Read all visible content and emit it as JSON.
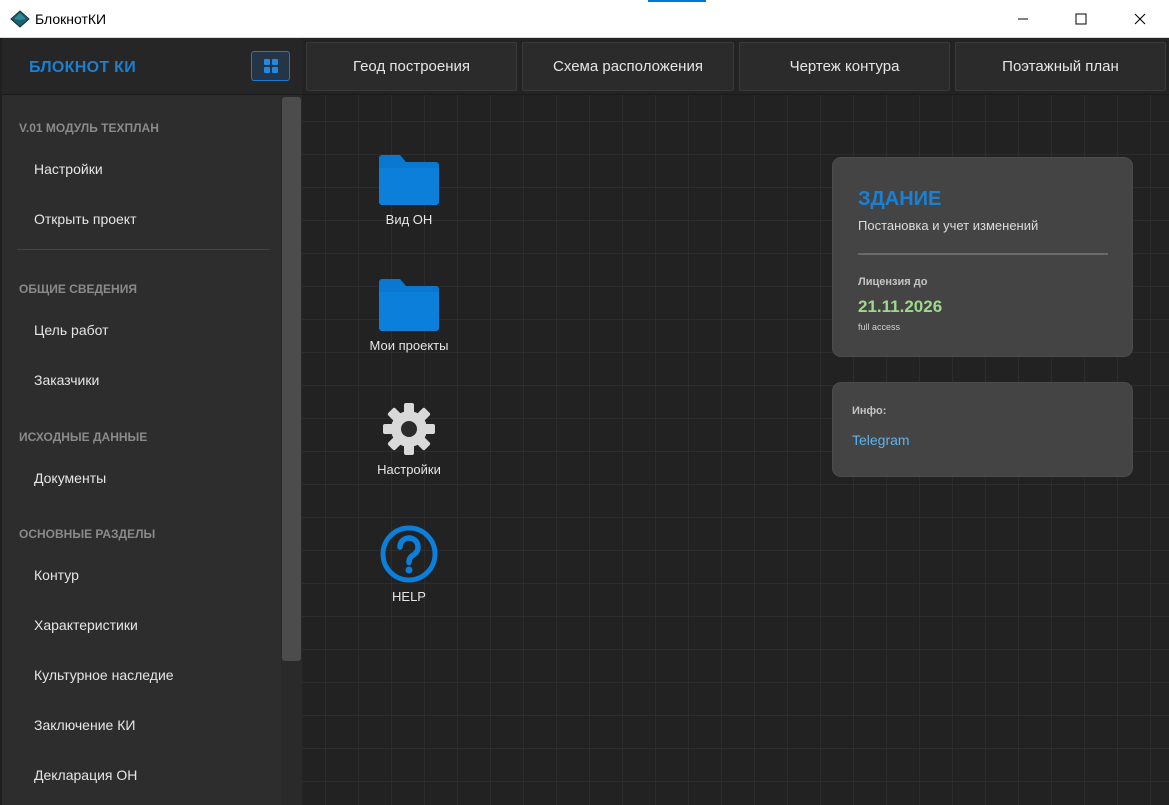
{
  "window": {
    "title": "БлокнотКИ",
    "minimize_icon": "minimize-icon",
    "maximize_icon": "maximize-icon",
    "close_icon": "close-icon"
  },
  "sidebar": {
    "brand": "БЛОКНОТ КИ",
    "grid_icon": "grid-icon",
    "sections": [
      {
        "header": "V.01 МОДУЛЬ ТЕХПЛАН",
        "items": [
          "Настройки",
          "Открыть проект"
        ]
      },
      {
        "header": "ОБЩИЕ СВЕДЕНИЯ",
        "items": [
          "Цель работ",
          "Заказчики"
        ]
      },
      {
        "header": "ИСХОДНЫЕ ДАННЫЕ",
        "items": [
          "Документы"
        ]
      },
      {
        "header": "ОСНОВНЫЕ РАЗДЕЛЫ",
        "items": [
          "Контур",
          "Характеристики",
          "Культурное наследие",
          "Заключение КИ",
          "Декларация ОН"
        ]
      }
    ]
  },
  "tabs": [
    "Геод построения",
    "Схема расположения",
    "Чертеж контура",
    "Поэтажный план"
  ],
  "desktop": {
    "icons": [
      {
        "label": "Вид ОН",
        "icon": "folder-icon"
      },
      {
        "label": "Мои проекты",
        "icon": "folder-icon"
      },
      {
        "label": "Настройки",
        "icon": "gear-icon"
      },
      {
        "label": "HELP",
        "icon": "help-icon"
      }
    ]
  },
  "cards": {
    "building": {
      "title": "ЗДАНИЕ",
      "subtitle": "Постановка и учет изменений",
      "license_label": "Лицензия до",
      "license_date": "21.11.2026",
      "access": "full access"
    },
    "info": {
      "label": "Инфо:",
      "link": "Telegram"
    }
  },
  "colors": {
    "accent": "#1a80d4",
    "license_date": "#9fd98b",
    "link": "#5fb4ee",
    "sidebar_bg": "#2d2d2d",
    "canvas_bg": "#222222"
  }
}
